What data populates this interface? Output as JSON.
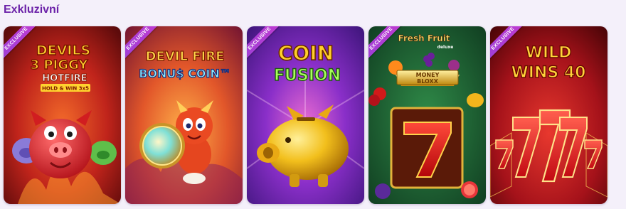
{
  "section": {
    "title": "Exkluzivní"
  },
  "ribbon_label": "EXCLUSIVE",
  "games": [
    {
      "logo_line1": "DEVILS",
      "logo_line2": "3 PIGGY",
      "logo_line3": "HOTFIRE",
      "logo_line4": "HOLD & WIN 3x5"
    },
    {
      "logo_line1": "DEVIL FIRE",
      "logo_line2": "BONU$ COIN™"
    },
    {
      "logo_line1": "COIN",
      "logo_line2": "FUSION"
    },
    {
      "logo_line1": "Fresh Fruit",
      "logo_line2": "deluxe",
      "logo_line3": "MONEY",
      "logo_line4": "BLOXX"
    },
    {
      "logo_line1": "WILD",
      "logo_line2": "WINS 40"
    }
  ],
  "colors": {
    "title": "#6b21a8",
    "ribbon": "#b13ad4"
  }
}
